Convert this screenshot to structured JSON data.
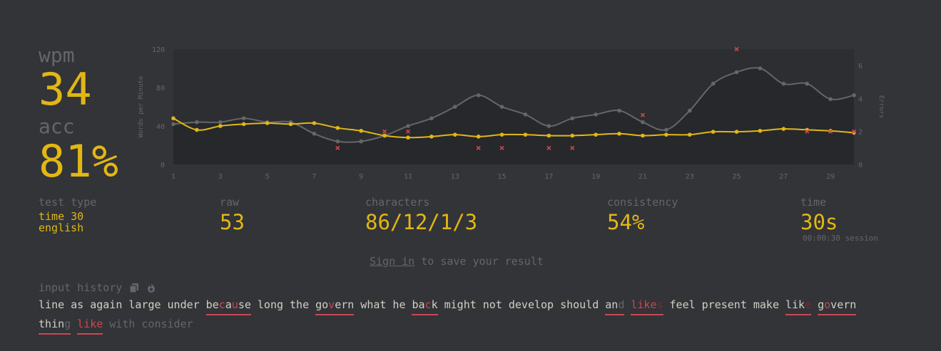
{
  "stats": {
    "wpm_label": "wpm",
    "wpm_value": "34",
    "acc_label": "acc",
    "acc_value": "81%"
  },
  "more_stats": {
    "test_type_label": "test type",
    "test_type_mode": "time 30",
    "test_type_language": "english",
    "raw_label": "raw",
    "raw_value": "53",
    "characters_label": "characters",
    "characters_value": "86/12/1/3",
    "consistency_label": "consistency",
    "consistency_value": "54%",
    "time_label": "time",
    "time_value": "30s",
    "session_time": "00:00:30 session"
  },
  "signin": {
    "link": "Sign in",
    "rest": " to save your result"
  },
  "history": {
    "label": "input history",
    "icons": [
      "copy-icon",
      "fire-icon"
    ],
    "words": [
      {
        "text": "line",
        "state": "correct"
      },
      {
        "text": "as",
        "state": "correct"
      },
      {
        "text": "again",
        "state": "correct"
      },
      {
        "text": "large",
        "state": "correct"
      },
      {
        "text": "under",
        "state": "correct"
      },
      {
        "text": "because",
        "state": "error",
        "incorrect": [
          2,
          4
        ]
      },
      {
        "text": "long",
        "state": "correct"
      },
      {
        "text": "the",
        "state": "correct"
      },
      {
        "text": "govern",
        "state": "error",
        "incorrect": [
          2
        ]
      },
      {
        "text": "what",
        "state": "correct"
      },
      {
        "text": "he",
        "state": "correct"
      },
      {
        "text": "back",
        "state": "error",
        "incorrect": [
          2
        ]
      },
      {
        "text": "might",
        "state": "correct"
      },
      {
        "text": "not",
        "state": "correct"
      },
      {
        "text": "develop",
        "state": "correct"
      },
      {
        "text": "should",
        "state": "correct"
      },
      {
        "text": "and",
        "state": "error",
        "missedFrom": 2
      },
      {
        "text": "likes",
        "state": "error",
        "allIncorrect": true,
        "extraFrom": 4
      },
      {
        "text": "feel",
        "state": "correct"
      },
      {
        "text": "present",
        "state": "correct"
      },
      {
        "text": "make",
        "state": "correct"
      },
      {
        "text": "like",
        "state": "error",
        "extraFrom": 3
      },
      {
        "text": "govern",
        "state": "error",
        "incorrect": [
          1
        ]
      },
      {
        "text": "thing",
        "state": "error",
        "missedFrom": 4
      },
      {
        "text": "like",
        "state": "error",
        "allIncorrect": true
      },
      {
        "text": "with",
        "state": "untyped"
      },
      {
        "text": "consider",
        "state": "untyped"
      }
    ]
  },
  "colors": {
    "background": "#323437",
    "main": "#e2b714",
    "sub": "#646669",
    "text": "#d1d0c5",
    "error": "#ca4754"
  },
  "chart_data": {
    "type": "line",
    "ylabel": "Words per Minute",
    "y2label": "Errors",
    "x": [
      1,
      2,
      3,
      4,
      5,
      6,
      7,
      8,
      9,
      10,
      11,
      12,
      13,
      14,
      15,
      16,
      17,
      18,
      19,
      20,
      21,
      22,
      23,
      24,
      25,
      26,
      27,
      28,
      29,
      30
    ],
    "x_ticks": [
      "1",
      "3",
      "5",
      "7",
      "9",
      "11",
      "13",
      "15",
      "17",
      "19",
      "21",
      "23",
      "25",
      "27",
      "29"
    ],
    "y_ticks": [
      "0",
      "40",
      "80",
      "120"
    ],
    "ylim": [
      0,
      120
    ],
    "y2_ticks": [
      "0",
      "2",
      "4",
      "6"
    ],
    "y2lim": [
      0,
      7
    ],
    "series": [
      {
        "name": "raw",
        "color": "#646669",
        "values": [
          42,
          44,
          44,
          48,
          44,
          44,
          32,
          24,
          24,
          30,
          40,
          48,
          60,
          72,
          60,
          52,
          40,
          48,
          52,
          56,
          44,
          36,
          56,
          84,
          96,
          100,
          84,
          84,
          68,
          72
        ]
      },
      {
        "name": "wpm",
        "color": "#e2b714",
        "values": [
          48,
          36,
          40,
          42,
          43,
          42,
          43,
          38,
          35,
          30,
          28,
          29,
          31,
          29,
          31,
          31,
          30,
          30,
          31,
          32,
          30,
          31,
          31,
          34,
          34,
          35,
          37,
          36,
          35,
          33
        ]
      }
    ],
    "errors": [
      {
        "x": 8,
        "y": 1
      },
      {
        "x": 10,
        "y": 2
      },
      {
        "x": 11,
        "y": 2
      },
      {
        "x": 14,
        "y": 1
      },
      {
        "x": 15,
        "y": 1
      },
      {
        "x": 17,
        "y": 1
      },
      {
        "x": 18,
        "y": 1
      },
      {
        "x": 21,
        "y": 3
      },
      {
        "x": 25,
        "y": 7
      },
      {
        "x": 28,
        "y": 2
      },
      {
        "x": 29,
        "y": 2
      },
      {
        "x": 30,
        "y": 2
      }
    ]
  }
}
